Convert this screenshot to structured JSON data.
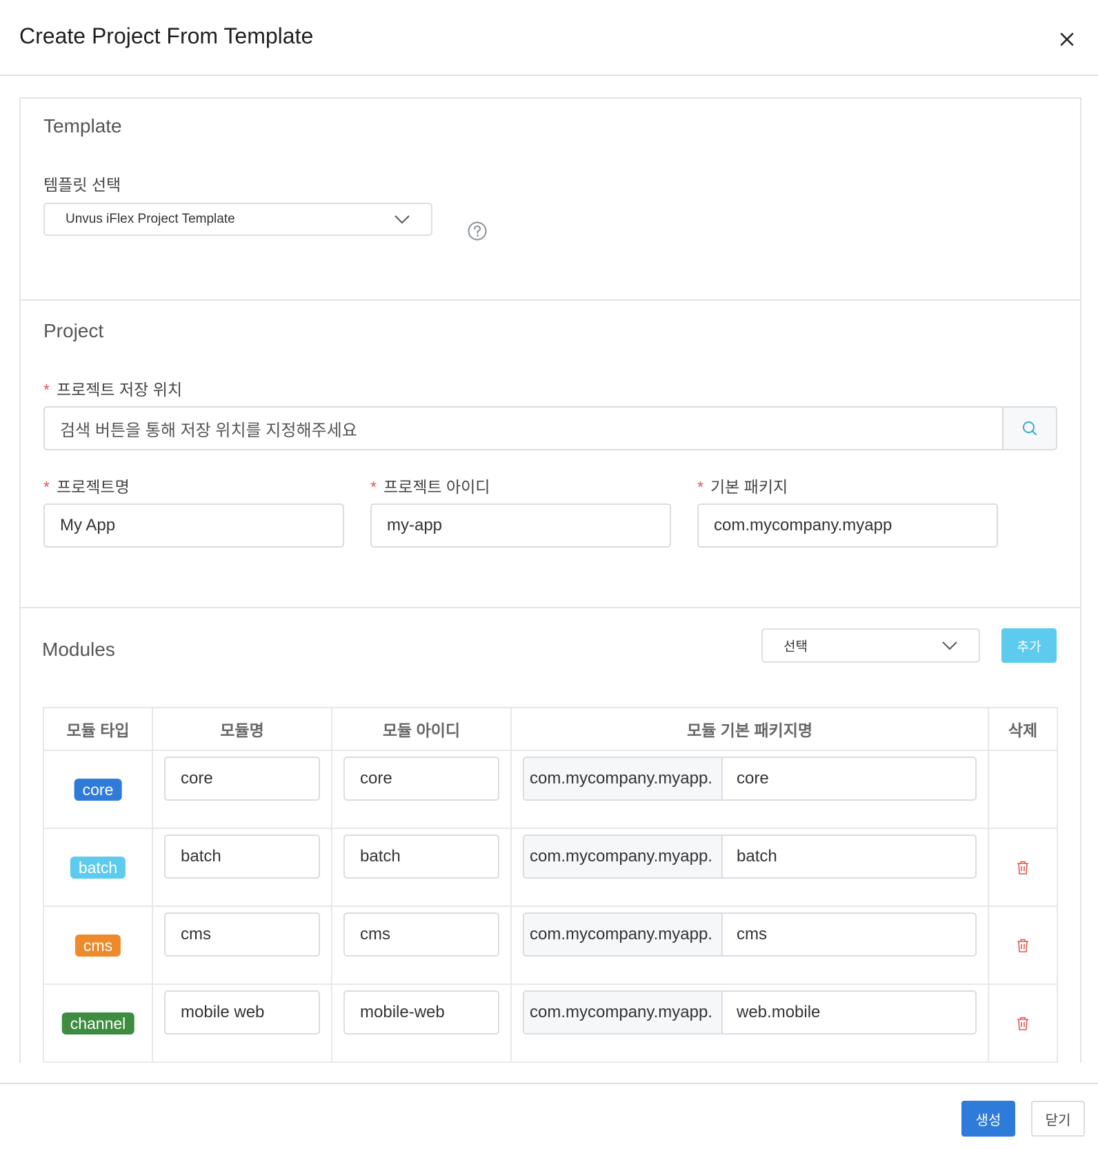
{
  "dialog": {
    "title": "Create Project From Template"
  },
  "template_section": {
    "title": "Template",
    "select_label": "템플릿 선택",
    "select_value": "Unvus iFlex Project Template"
  },
  "project_section": {
    "title": "Project",
    "required_mark": "*",
    "location_label": "프로젝트 저장 위치",
    "location_placeholder": "검색 버튼을 통해 저장 위치를 지정해주세요",
    "name_label": "프로젝트명",
    "name_value": "My App",
    "id_label": "프로젝트 아이디",
    "id_value": "my-app",
    "package_label": "기본 패키지",
    "package_value": "com.mycompany.myapp"
  },
  "modules_section": {
    "title": "Modules",
    "select_value": "선택",
    "add_label": "추가",
    "columns": [
      "모듈 타입",
      "모듈명",
      "모듈 아이디",
      "모듈 기본 패키지명",
      "삭제"
    ],
    "rows": [
      {
        "type": "core",
        "type_color": "#2f7bd9",
        "name": "core",
        "id": "core",
        "pkg_prefix": "com.mycompany.myapp.",
        "pkg_suffix": "core",
        "deletable": false
      },
      {
        "type": "batch",
        "type_color": "#5ccbed",
        "name": "batch",
        "id": "batch",
        "pkg_prefix": "com.mycompany.myapp.",
        "pkg_suffix": "batch",
        "deletable": true
      },
      {
        "type": "cms",
        "type_color": "#ec8a2c",
        "name": "cms",
        "id": "cms",
        "pkg_prefix": "com.mycompany.myapp.",
        "pkg_suffix": "cms",
        "deletable": true
      },
      {
        "type": "channel",
        "type_color": "#3d8c3f",
        "name": "mobile web",
        "id": "mobile-web",
        "pkg_prefix": "com.mycompany.myapp.",
        "pkg_suffix": "web.mobile",
        "deletable": true
      }
    ]
  },
  "footer": {
    "create_label": "생성",
    "close_label": "닫기"
  },
  "colors": {
    "primary": "#2f7bd9",
    "accent": "#5ccbed",
    "required": "#e2554e",
    "delete": "#e2554e"
  }
}
